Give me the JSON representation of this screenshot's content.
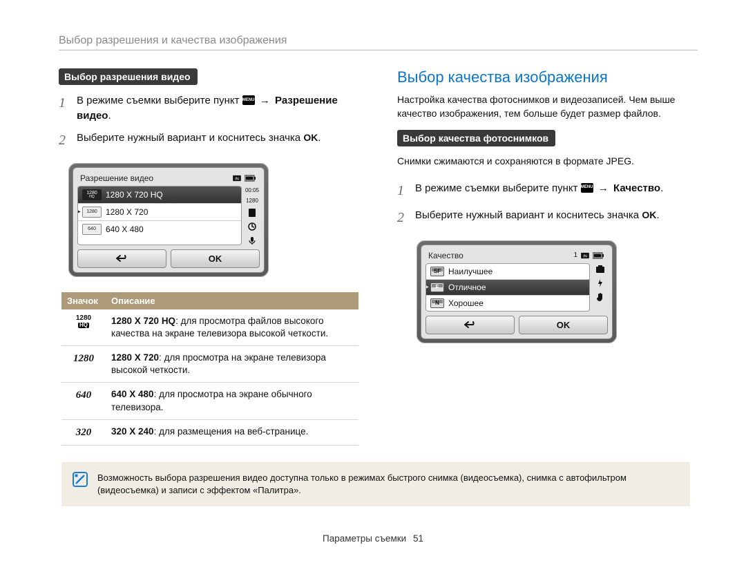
{
  "header": {
    "title": "Выбор разрешения и качества изображения"
  },
  "left": {
    "section_label": "Выбор разрешения видео",
    "step1_a": "В режиме съемки выберите пункт ",
    "step1_b": "Разрешение видео",
    "step1_dot": ".",
    "step2": "Выберите нужный вариант и коснитесь значка ",
    "ok": "OK",
    "dot": ".",
    "menu_label": "MENU",
    "arrow": "→",
    "screen": {
      "title": "Разрешение видео",
      "time": "00:05",
      "time_side": "1280",
      "rows": [
        {
          "chip_top": "1280",
          "chip_sub": "HQ",
          "label": "1280 X 720 HQ"
        },
        {
          "chip_top": "1280",
          "chip_sub": "",
          "label": "1280 X 720"
        },
        {
          "chip_top": "640",
          "chip_sub": "",
          "label": "640 X 480"
        }
      ],
      "back": "↶",
      "ok": "OK"
    },
    "table": {
      "h_icon": "Значок",
      "h_desc": "Описание",
      "rows": [
        {
          "icon_main": "1280",
          "icon_sub": "HQ",
          "b": "1280 X 720 HQ",
          "rest": ": для просмотра файлов высокого качества на экране телевизора высокой четкости."
        },
        {
          "icon_main": "1280",
          "icon_sub": "",
          "b": "1280 X 720",
          "rest": ": для просмотра на экране телевизора высокой четкости."
        },
        {
          "icon_main": "640",
          "icon_sub": "",
          "b": "640 X 480",
          "rest": ": для просмотра на экране обычного телевизора."
        },
        {
          "icon_main": "320",
          "icon_sub": "",
          "b": "320 X 240",
          "rest": ": для размещения на веб-странице."
        }
      ]
    }
  },
  "note": {
    "text": "Возможность выбора разрешения видео доступна только в режимах быстрого снимка (видеосъемка), снимка с автофильтром (видеосъемка) и записи с эффектом «Палитра»."
  },
  "right": {
    "title": "Выбор качества изображения",
    "para": "Настройка качества фотоснимков и видеозаписей. Чем выше качество изображения, тем больше будет размер файлов.",
    "section_label": "Выбор качества фотоснимков",
    "jpeg": "Снимки сжимаются и сохраняются в формате JPEG.",
    "step1_a": "В режиме съемки выберите пункт ",
    "step1_b": "Качество",
    "step1_dot": ".",
    "step2": "Выберите нужный вариант и коснитесь значка ",
    "ok": "OK",
    "dot": ".",
    "screen": {
      "title": "Качество",
      "count": "1",
      "rows": [
        {
          "chip": "SF",
          "label": "Наилучшее"
        },
        {
          "chip": "F",
          "label": "Отличное"
        },
        {
          "chip": "N",
          "label": "Хорошее"
        }
      ],
      "back": "↶",
      "ok": "OK"
    }
  },
  "footer": {
    "section": "Параметры съемки",
    "page": "51"
  }
}
